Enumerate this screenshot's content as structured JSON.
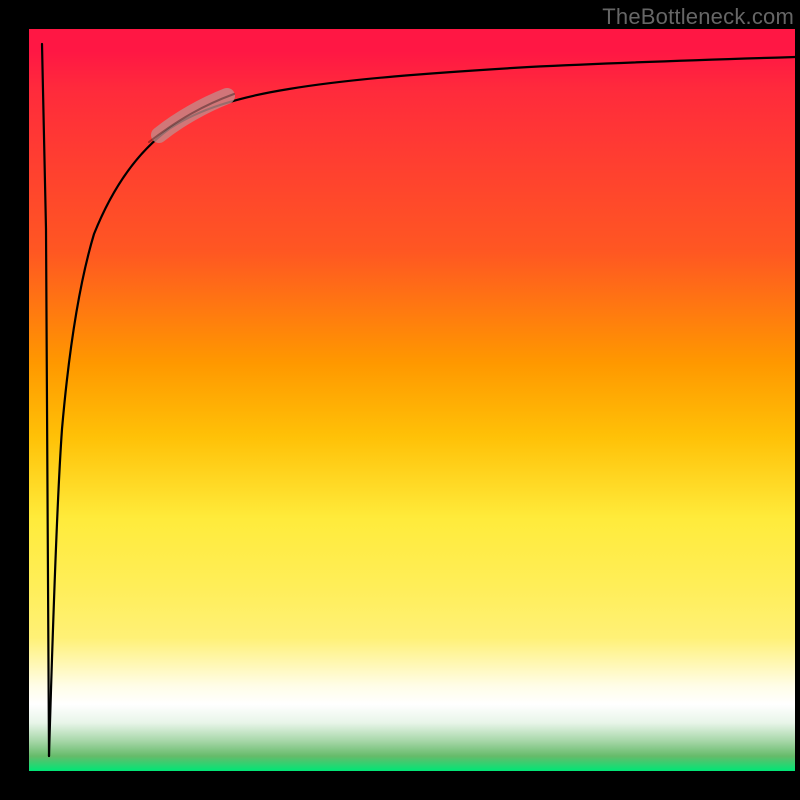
{
  "watermark": "TheBottleneck.com",
  "chart_data": {
    "type": "line",
    "title": "",
    "xlabel": "",
    "ylabel": "",
    "xlim": [
      0,
      100
    ],
    "ylim": [
      0,
      100
    ],
    "grid": false,
    "background_gradient": {
      "orientation": "vertical",
      "stops": [
        {
          "pos": 0.0,
          "color": "#ff1744"
        },
        {
          "pos": 0.3,
          "color": "#ff5722"
        },
        {
          "pos": 0.45,
          "color": "#ff9800"
        },
        {
          "pos": 0.6,
          "color": "#ffc107"
        },
        {
          "pos": 0.72,
          "color": "#ffeb3b"
        },
        {
          "pos": 0.88,
          "color": "#fffde7"
        },
        {
          "pos": 0.94,
          "color": "#e8f5e9"
        },
        {
          "pos": 1.0,
          "color": "#00e676"
        }
      ]
    },
    "series": [
      {
        "name": "bottleneck-curve",
        "color": "#000000",
        "x": [
          3.5,
          3.6,
          3.8,
          4.1,
          4.5,
          5.0,
          6.0,
          7.0,
          8.5,
          10,
          12,
          15,
          18,
          22,
          28,
          35,
          45,
          60,
          80,
          100
        ],
        "y": [
          2,
          20,
          35,
          46,
          54,
          60,
          68,
          73,
          78,
          81,
          83.5,
          86,
          87.5,
          89,
          90.5,
          91.8,
          92.8,
          93.7,
          94.5,
          95
        ]
      },
      {
        "name": "initial-drop",
        "color": "#000000",
        "x": [
          3.0,
          3.2,
          3.5
        ],
        "y": [
          95,
          50,
          2
        ]
      }
    ],
    "highlight_segment": {
      "on_series": "bottleneck-curve",
      "x_start": 17,
      "x_end": 26,
      "color": "#c48b8b",
      "width": 14
    }
  }
}
